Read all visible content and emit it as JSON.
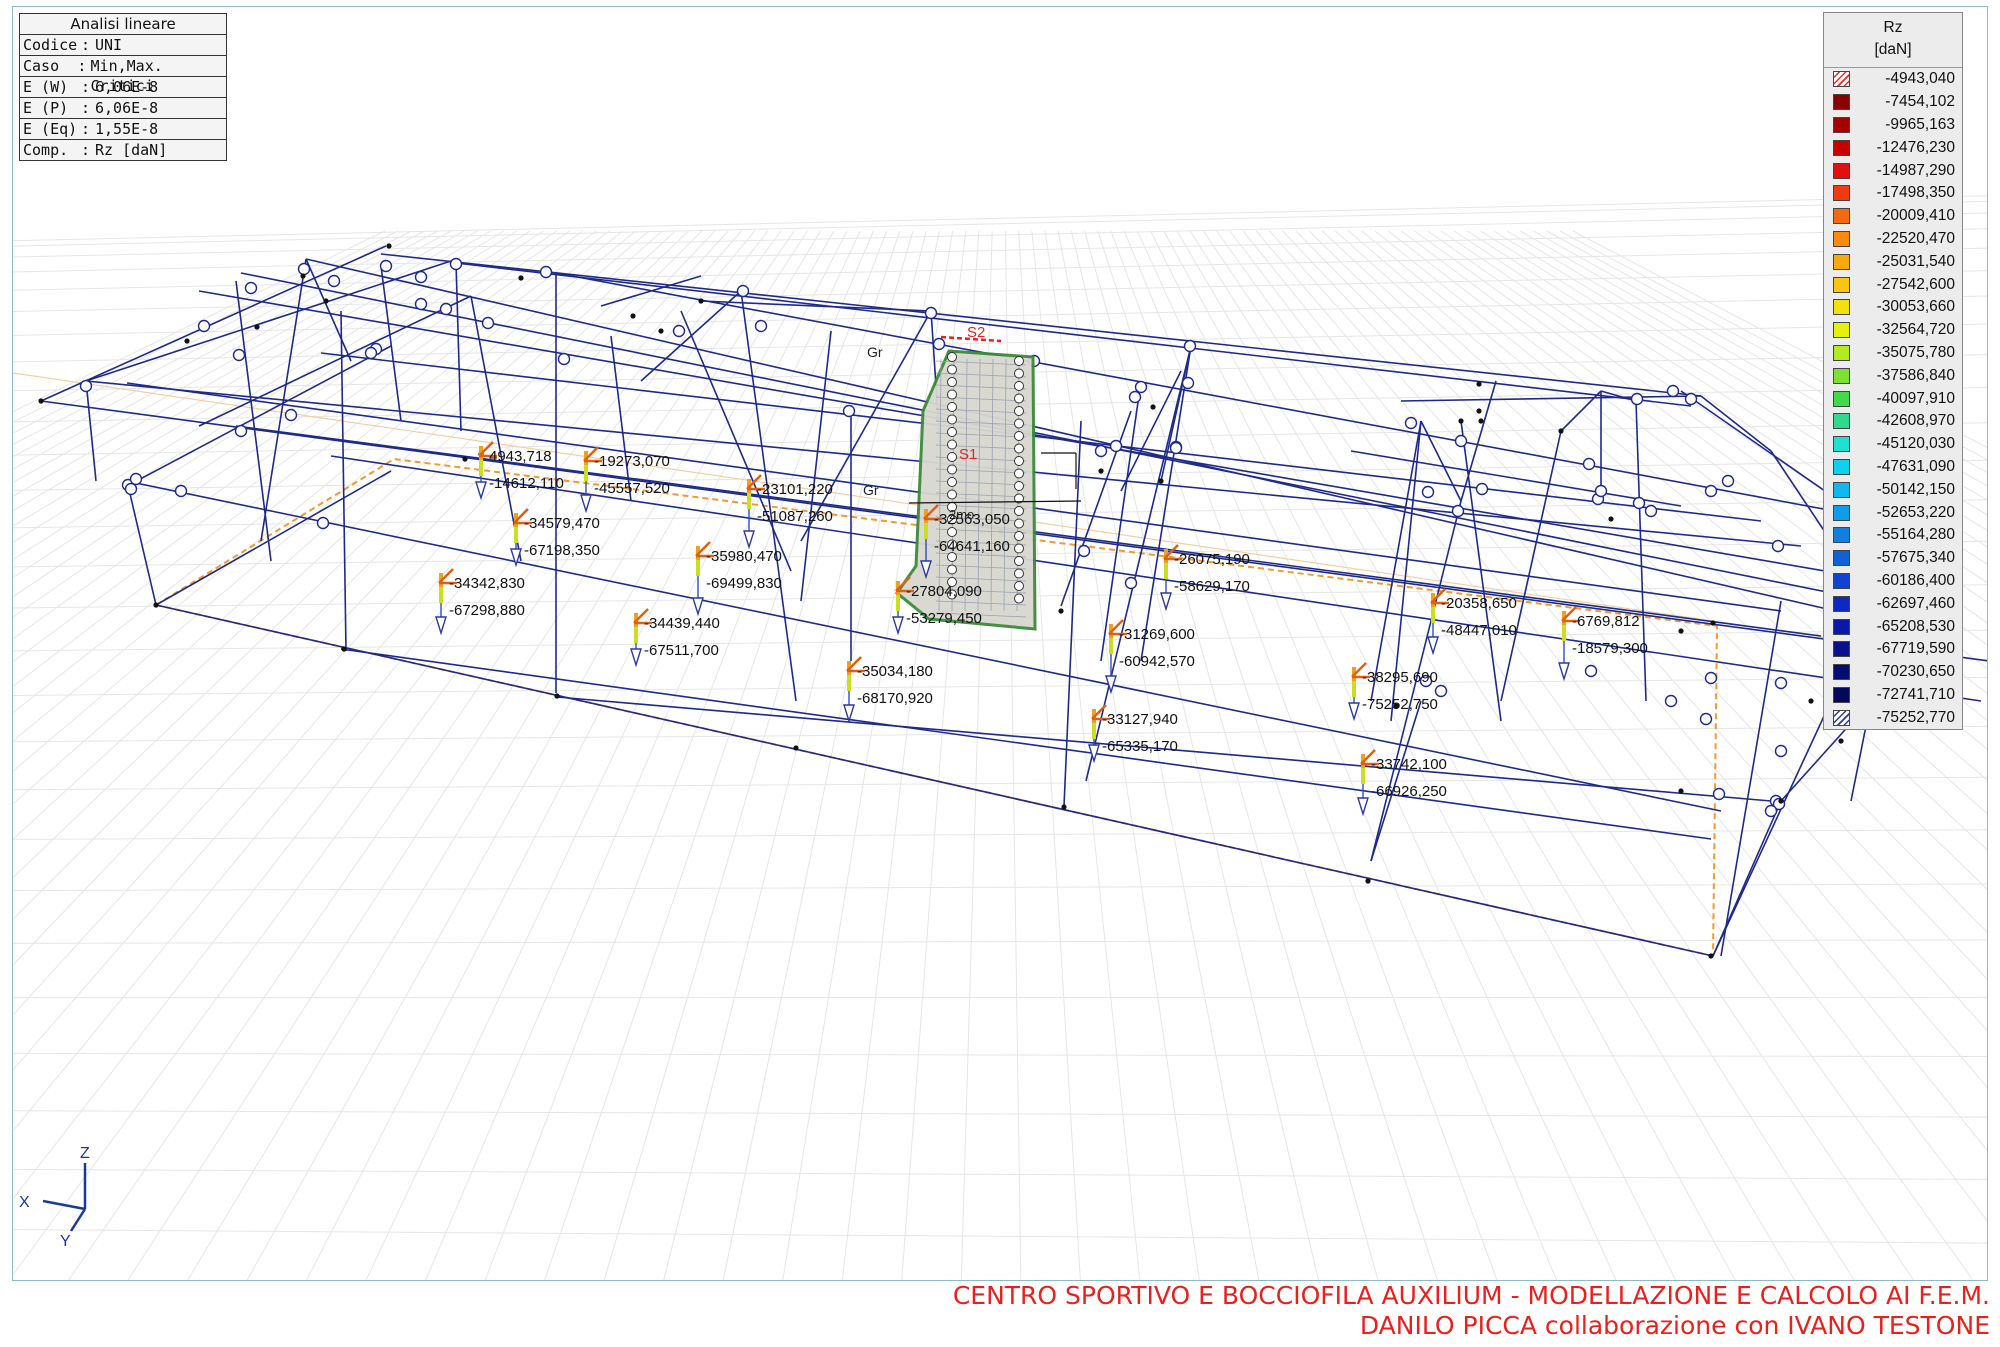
{
  "info": {
    "title": "Analisi lineare",
    "rows": [
      {
        "k": "Codice",
        "v": "UNI"
      },
      {
        "k": "Caso",
        "v": "Min,Max. Critici"
      },
      {
        "k": "E (W)",
        "v": "6,06E-8"
      },
      {
        "k": "E (P)",
        "v": "6,06E-8"
      },
      {
        "k": "E (Eq)",
        "v": "1,55E-8"
      },
      {
        "k": "Comp.",
        "v": "Rz [daN]"
      }
    ]
  },
  "legend": {
    "title": "Rz",
    "unit": "[daN]",
    "entries": [
      {
        "v": "-4943,040",
        "c": "hatch-red"
      },
      {
        "v": "-7454,102",
        "c": "#8b0000"
      },
      {
        "v": "-9965,163",
        "c": "#a60000"
      },
      {
        "v": "-12476,230",
        "c": "#c40000"
      },
      {
        "v": "-14987,290",
        "c": "#e01010"
      },
      {
        "v": "-17498,350",
        "c": "#f03a10"
      },
      {
        "v": "-20009,410",
        "c": "#f56a10"
      },
      {
        "v": "-22520,470",
        "c": "#f88a10"
      },
      {
        "v": "-25031,540",
        "c": "#f9a910"
      },
      {
        "v": "-27542,600",
        "c": "#fac510"
      },
      {
        "v": "-30053,660",
        "c": "#f4e010"
      },
      {
        "v": "-32564,720",
        "c": "#e6f010"
      },
      {
        "v": "-35075,780",
        "c": "#b6ea20"
      },
      {
        "v": "-37586,840",
        "c": "#7ee030"
      },
      {
        "v": "-40097,910",
        "c": "#45d848"
      },
      {
        "v": "-42608,970",
        "c": "#30d890"
      },
      {
        "v": "-45120,030",
        "c": "#20e0d0"
      },
      {
        "v": "-47631,090",
        "c": "#10d0f0"
      },
      {
        "v": "-50142,150",
        "c": "#10b8f0"
      },
      {
        "v": "-52653,220",
        "c": "#109ce8"
      },
      {
        "v": "-55164,280",
        "c": "#1080e0"
      },
      {
        "v": "-57675,340",
        "c": "#1060d8"
      },
      {
        "v": "-60186,400",
        "c": "#1044d0"
      },
      {
        "v": "-62697,460",
        "c": "#1028c0"
      },
      {
        "v": "-65208,530",
        "c": "#0a18a8"
      },
      {
        "v": "-67719,590",
        "c": "#08108c"
      },
      {
        "v": "-70230,650",
        "c": "#060c70"
      },
      {
        "v": "-72741,710",
        "c": "#040858"
      },
      {
        "v": "-75252,770",
        "c": "hatch-blue"
      }
    ]
  },
  "reactions": [
    {
      "top": "4943,718",
      "bottom": "-14612,110"
    },
    {
      "top": "-19273,070",
      "bottom": "-45557,520"
    },
    {
      "top": "-23101,220",
      "bottom": "-51087,260"
    },
    {
      "top": "-34579,470",
      "bottom": "-67198,350"
    },
    {
      "top": "-34342,830",
      "bottom": "-67298,880"
    },
    {
      "top": "-35980,470",
      "bottom": "-69499,830"
    },
    {
      "top": "-34439,440",
      "bottom": "-67511,700"
    },
    {
      "top": "-35034,180",
      "bottom": "-68170,920"
    },
    {
      "top": "-32563,050",
      "bottom": "-64641,160"
    },
    {
      "top": "-27804,090",
      "bottom": "-53279,450"
    },
    {
      "top": "-26075,190",
      "bottom": "-58629,170"
    },
    {
      "top": "-31269,600",
      "bottom": "-60942,570"
    },
    {
      "top": "-33127,940",
      "bottom": "-65335,170"
    },
    {
      "top": "-20358,650",
      "bottom": "-48447,010"
    },
    {
      "top": "-6769,812",
      "bottom": "-18579,300"
    },
    {
      "top": "-38295,690",
      "bottom": "-75252,750"
    },
    {
      "top": "-33742,100",
      "bottom": "-66926,250"
    }
  ],
  "labels": {
    "s1": "S1",
    "s2": "S2",
    "gr_a": "Gr",
    "gr_b": "Gr",
    "mid": "2mo"
  },
  "axes": {
    "x": "X",
    "y": "Y",
    "z": "Z"
  },
  "credits": {
    "line1": "CENTRO SPORTIVO E BOCCIOFILA AUXILIUM - MODELLAZIONE E CALCOLO AI F.E.M.",
    "line2": "DANILO PICCA collaborazione con IVANO TESTONE"
  }
}
